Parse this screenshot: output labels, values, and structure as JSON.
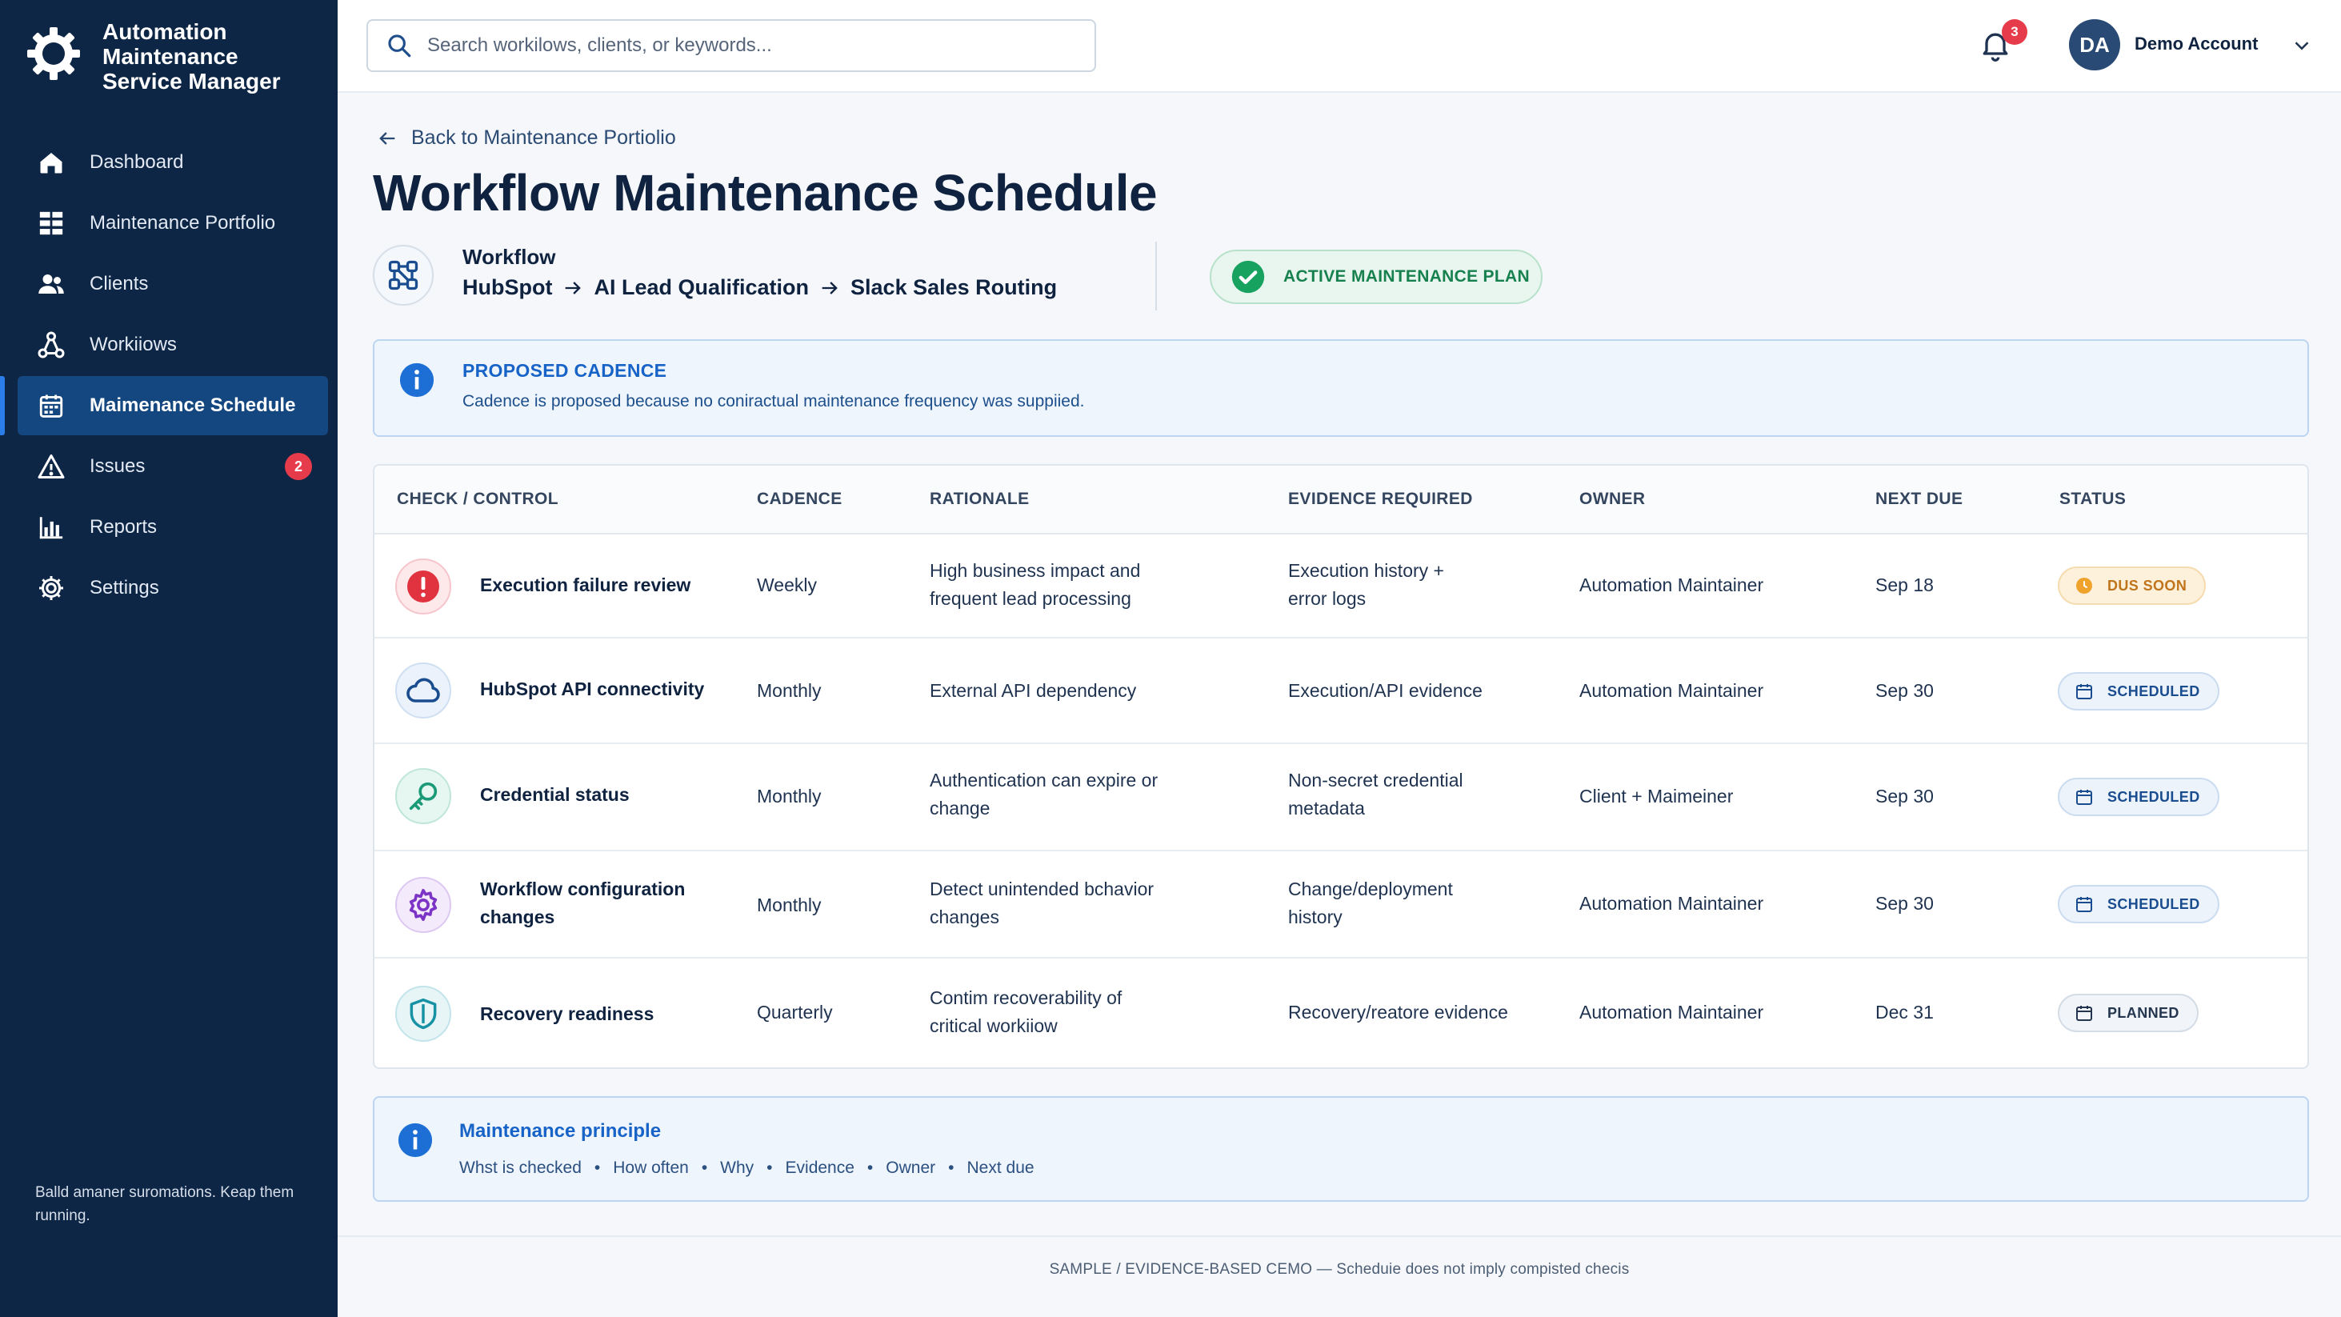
{
  "app": {
    "brand_name": "Automation Maintenance Service Manager",
    "tagline": "Balld amaner suromations. Keap them running."
  },
  "sidebar": {
    "items": [
      {
        "label": "Dashboard",
        "icon": "home-icon"
      },
      {
        "label": "Maintenance Portfolio",
        "icon": "grid-icon"
      },
      {
        "label": "Clients",
        "icon": "users-icon"
      },
      {
        "label": "Workiiows",
        "icon": "workflow-icon"
      },
      {
        "label": "Maimenance Schedule",
        "icon": "calendar-icon",
        "active": true
      },
      {
        "label": "Issues",
        "icon": "warning-icon",
        "badge": "2"
      },
      {
        "label": "Reports",
        "icon": "bar-chart-icon"
      },
      {
        "label": "Settings",
        "icon": "gear-icon"
      }
    ]
  },
  "topbar": {
    "search_placeholder": "Search workilows, clients, or keywords...",
    "notification_count": "3",
    "avatar_initials": "DA",
    "account_name": "Demo Account"
  },
  "page": {
    "back_label": "Back to Maintenance Portiolio",
    "title": "Workflow Maintenance Schedule",
    "workflow_label": "Workflow",
    "workflow_steps": [
      "HubSpot",
      "AI Lead Qualification",
      "Slack Sales Routing"
    ],
    "plan_status": "ACTIVE MAINTENANCE PLAN"
  },
  "notice": {
    "title": "PROPOSED CADENCE",
    "text": "Cadence is proposed because no coniractual maintenance frequency was suppiied."
  },
  "table": {
    "headers": [
      "CHECK / CONTROL",
      "CADENCE",
      "RATIONALE",
      "EVIDENCE REQUIRED",
      "OWNER",
      "NEXT DUE",
      "STATUS"
    ],
    "rows": [
      {
        "icon": "alert-icon",
        "check": "Execution failure review",
        "cadence": "Weekly",
        "rationale": "High business impact and frequent lead processing",
        "evidence": "Execution history + error logs",
        "owner": "Automation Maintainer",
        "next_due": "Sep 18",
        "status": "DUS SOON",
        "status_type": "due"
      },
      {
        "icon": "cloud-icon",
        "check": "HubSpot API connectivity",
        "cadence": "Monthly",
        "rationale": "External API dependency",
        "evidence": "Execution/API evidence",
        "owner": "Automation Maintainer",
        "next_due": "Sep 30",
        "status": "SCHEDULED",
        "status_type": "scheduled"
      },
      {
        "icon": "key-icon",
        "check": "Credential status",
        "cadence": "Monthly",
        "rationale": "Authentication can expire or change",
        "evidence": "Non-secret credential metadata",
        "owner": "Client + Maimeiner",
        "next_due": "Sep 30",
        "status": "SCHEDULED",
        "status_type": "scheduled"
      },
      {
        "icon": "gear-icon",
        "check": "Workflow configuration changes",
        "cadence": "Monthly",
        "rationale": "Detect unintended bchavior changes",
        "evidence": "Change/deployment history",
        "owner": "Automation Maintainer",
        "next_due": "Sep 30",
        "status": "SCHEDULED",
        "status_type": "scheduled"
      },
      {
        "icon": "shield-icon",
        "check": "Recovery readiness",
        "cadence": "Quarterly",
        "rationale": "Contim recoverability of critical workiiow",
        "evidence": "Recovery/reatore evidence",
        "owner": "Automation Maintainer",
        "next_due": "Dec 31",
        "status": "PLANNED",
        "status_type": "planned"
      }
    ]
  },
  "principle": {
    "title": "Maintenance principle",
    "items": [
      "Whst is checked",
      "How often",
      "Why",
      "Evidence",
      "Owner",
      "Next due"
    ]
  },
  "footer": {
    "text": "SAMPLE  /  EVIDENCE-BASED CEMO — Scheduie does not imply compisted checis"
  },
  "colors": {
    "sidebar_bg": "#0e2645",
    "accent": "#1763c7",
    "success": "#17804f",
    "danger": "#e63b4a",
    "warning": "#c0741b"
  }
}
